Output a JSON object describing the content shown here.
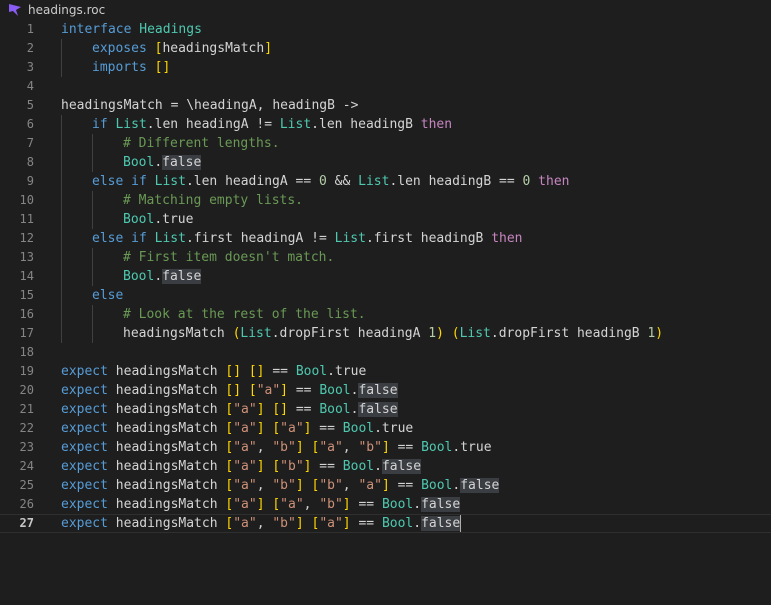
{
  "tab": {
    "filename": "headings.roc"
  },
  "active_line": 27,
  "lines": [
    {
      "n": 1,
      "indent": 0,
      "tokens": [
        [
          "kw",
          "interface"
        ],
        [
          "id",
          " "
        ],
        [
          "ty",
          "Headings"
        ]
      ]
    },
    {
      "n": 2,
      "indent": 1,
      "tokens": [
        [
          "kw",
          "exposes"
        ],
        [
          "id",
          " "
        ],
        [
          "br",
          "["
        ],
        [
          "id",
          "headingsMatch"
        ],
        [
          "br",
          "]"
        ]
      ]
    },
    {
      "n": 3,
      "indent": 1,
      "tokens": [
        [
          "kw",
          "imports"
        ],
        [
          "id",
          " "
        ],
        [
          "br",
          "[]"
        ]
      ]
    },
    {
      "n": 4,
      "indent": 0,
      "tokens": []
    },
    {
      "n": 5,
      "indent": 0,
      "tokens": [
        [
          "id",
          "headingsMatch = \\headingA, headingB ->"
        ]
      ]
    },
    {
      "n": 6,
      "indent": 1,
      "tokens": [
        [
          "kw",
          "if"
        ],
        [
          "id",
          " "
        ],
        [
          "ty",
          "List"
        ],
        [
          "id",
          ".len headingA != "
        ],
        [
          "ty",
          "List"
        ],
        [
          "id",
          ".len headingB "
        ],
        [
          "kc",
          "then"
        ]
      ]
    },
    {
      "n": 7,
      "indent": 2,
      "tokens": [
        [
          "cm",
          "# Different lengths."
        ]
      ]
    },
    {
      "n": 8,
      "indent": 2,
      "tokens": [
        [
          "ty",
          "Bool"
        ],
        [
          "id",
          "."
        ],
        [
          "hl",
          "false"
        ]
      ]
    },
    {
      "n": 9,
      "indent": 1,
      "tokens": [
        [
          "kw",
          "else if"
        ],
        [
          "id",
          " "
        ],
        [
          "ty",
          "List"
        ],
        [
          "id",
          ".len headingA == "
        ],
        [
          "nu",
          "0"
        ],
        [
          "id",
          " && "
        ],
        [
          "ty",
          "List"
        ],
        [
          "id",
          ".len headingB == "
        ],
        [
          "nu",
          "0"
        ],
        [
          "id",
          " "
        ],
        [
          "kc",
          "then"
        ]
      ]
    },
    {
      "n": 10,
      "indent": 2,
      "tokens": [
        [
          "cm",
          "# Matching empty lists."
        ]
      ]
    },
    {
      "n": 11,
      "indent": 2,
      "tokens": [
        [
          "ty",
          "Bool"
        ],
        [
          "id",
          ".true"
        ]
      ]
    },
    {
      "n": 12,
      "indent": 1,
      "tokens": [
        [
          "kw",
          "else if"
        ],
        [
          "id",
          " "
        ],
        [
          "ty",
          "List"
        ],
        [
          "id",
          ".first headingA != "
        ],
        [
          "ty",
          "List"
        ],
        [
          "id",
          ".first headingB "
        ],
        [
          "kc",
          "then"
        ]
      ]
    },
    {
      "n": 13,
      "indent": 2,
      "tokens": [
        [
          "cm",
          "# First item doesn't match."
        ]
      ]
    },
    {
      "n": 14,
      "indent": 2,
      "tokens": [
        [
          "ty",
          "Bool"
        ],
        [
          "id",
          "."
        ],
        [
          "hl",
          "false"
        ]
      ]
    },
    {
      "n": 15,
      "indent": 1,
      "tokens": [
        [
          "kw",
          "else"
        ]
      ]
    },
    {
      "n": 16,
      "indent": 2,
      "tokens": [
        [
          "cm",
          "# Look at the rest of the list."
        ]
      ]
    },
    {
      "n": 17,
      "indent": 2,
      "tokens": [
        [
          "id",
          "headingsMatch "
        ],
        [
          "br",
          "("
        ],
        [
          "ty",
          "List"
        ],
        [
          "id",
          ".dropFirst headingA "
        ],
        [
          "nu",
          "1"
        ],
        [
          "br",
          ")"
        ],
        [
          "id",
          " "
        ],
        [
          "br",
          "("
        ],
        [
          "ty",
          "List"
        ],
        [
          "id",
          ".dropFirst headingB "
        ],
        [
          "nu",
          "1"
        ],
        [
          "br",
          ")"
        ]
      ]
    },
    {
      "n": 18,
      "indent": 0,
      "tokens": []
    },
    {
      "n": 19,
      "indent": 0,
      "tokens": [
        [
          "kw",
          "expect"
        ],
        [
          "id",
          " headingsMatch "
        ],
        [
          "br",
          "[]"
        ],
        [
          "id",
          " "
        ],
        [
          "br",
          "[]"
        ],
        [
          "id",
          " == "
        ],
        [
          "ty",
          "Bool"
        ],
        [
          "id",
          ".true"
        ]
      ]
    },
    {
      "n": 20,
      "indent": 0,
      "tokens": [
        [
          "kw",
          "expect"
        ],
        [
          "id",
          " headingsMatch "
        ],
        [
          "br",
          "[]"
        ],
        [
          "id",
          " "
        ],
        [
          "br",
          "["
        ],
        [
          "st",
          "\"a\""
        ],
        [
          "br",
          "]"
        ],
        [
          "id",
          " == "
        ],
        [
          "ty",
          "Bool"
        ],
        [
          "id",
          "."
        ],
        [
          "hl",
          "false"
        ]
      ]
    },
    {
      "n": 21,
      "indent": 0,
      "tokens": [
        [
          "kw",
          "expect"
        ],
        [
          "id",
          " headingsMatch "
        ],
        [
          "br",
          "["
        ],
        [
          "st",
          "\"a\""
        ],
        [
          "br",
          "]"
        ],
        [
          "id",
          " "
        ],
        [
          "br",
          "[]"
        ],
        [
          "id",
          " == "
        ],
        [
          "ty",
          "Bool"
        ],
        [
          "id",
          "."
        ],
        [
          "hl",
          "false"
        ]
      ]
    },
    {
      "n": 22,
      "indent": 0,
      "tokens": [
        [
          "kw",
          "expect"
        ],
        [
          "id",
          " headingsMatch "
        ],
        [
          "br",
          "["
        ],
        [
          "st",
          "\"a\""
        ],
        [
          "br",
          "]"
        ],
        [
          "id",
          " "
        ],
        [
          "br",
          "["
        ],
        [
          "st",
          "\"a\""
        ],
        [
          "br",
          "]"
        ],
        [
          "id",
          " == "
        ],
        [
          "ty",
          "Bool"
        ],
        [
          "id",
          ".true"
        ]
      ]
    },
    {
      "n": 23,
      "indent": 0,
      "tokens": [
        [
          "kw",
          "expect"
        ],
        [
          "id",
          " headingsMatch "
        ],
        [
          "br",
          "["
        ],
        [
          "st",
          "\"a\""
        ],
        [
          "id",
          ", "
        ],
        [
          "st",
          "\"b\""
        ],
        [
          "br",
          "]"
        ],
        [
          "id",
          " "
        ],
        [
          "br",
          "["
        ],
        [
          "st",
          "\"a\""
        ],
        [
          "id",
          ", "
        ],
        [
          "st",
          "\"b\""
        ],
        [
          "br",
          "]"
        ],
        [
          "id",
          " == "
        ],
        [
          "ty",
          "Bool"
        ],
        [
          "id",
          ".true"
        ]
      ]
    },
    {
      "n": 24,
      "indent": 0,
      "tokens": [
        [
          "kw",
          "expect"
        ],
        [
          "id",
          " headingsMatch "
        ],
        [
          "br",
          "["
        ],
        [
          "st",
          "\"a\""
        ],
        [
          "br",
          "]"
        ],
        [
          "id",
          " "
        ],
        [
          "br",
          "["
        ],
        [
          "st",
          "\"b\""
        ],
        [
          "br",
          "]"
        ],
        [
          "id",
          " == "
        ],
        [
          "ty",
          "Bool"
        ],
        [
          "id",
          "."
        ],
        [
          "hl",
          "false"
        ]
      ]
    },
    {
      "n": 25,
      "indent": 0,
      "tokens": [
        [
          "kw",
          "expect"
        ],
        [
          "id",
          " headingsMatch "
        ],
        [
          "br",
          "["
        ],
        [
          "st",
          "\"a\""
        ],
        [
          "id",
          ", "
        ],
        [
          "st",
          "\"b\""
        ],
        [
          "br",
          "]"
        ],
        [
          "id",
          " "
        ],
        [
          "br",
          "["
        ],
        [
          "st",
          "\"b\""
        ],
        [
          "id",
          ", "
        ],
        [
          "st",
          "\"a\""
        ],
        [
          "br",
          "]"
        ],
        [
          "id",
          " == "
        ],
        [
          "ty",
          "Bool"
        ],
        [
          "id",
          "."
        ],
        [
          "hl",
          "false"
        ]
      ]
    },
    {
      "n": 26,
      "indent": 0,
      "tokens": [
        [
          "kw",
          "expect"
        ],
        [
          "id",
          " headingsMatch "
        ],
        [
          "br",
          "["
        ],
        [
          "st",
          "\"a\""
        ],
        [
          "br",
          "]"
        ],
        [
          "id",
          " "
        ],
        [
          "br",
          "["
        ],
        [
          "st",
          "\"a\""
        ],
        [
          "id",
          ", "
        ],
        [
          "st",
          "\"b\""
        ],
        [
          "br",
          "]"
        ],
        [
          "id",
          " == "
        ],
        [
          "ty",
          "Bool"
        ],
        [
          "id",
          "."
        ],
        [
          "hl",
          "false"
        ]
      ]
    },
    {
      "n": 27,
      "indent": 0,
      "tokens": [
        [
          "kw",
          "expect"
        ],
        [
          "id",
          " headingsMatch "
        ],
        [
          "br",
          "["
        ],
        [
          "st",
          "\"a\""
        ],
        [
          "id",
          ", "
        ],
        [
          "st",
          "\"b\""
        ],
        [
          "br",
          "]"
        ],
        [
          "id",
          " "
        ],
        [
          "br",
          "["
        ],
        [
          "st",
          "\"a\""
        ],
        [
          "br",
          "]"
        ],
        [
          "id",
          " == "
        ],
        [
          "ty",
          "Bool"
        ],
        [
          "id",
          "."
        ],
        [
          "hl",
          "false"
        ]
      ]
    }
  ]
}
